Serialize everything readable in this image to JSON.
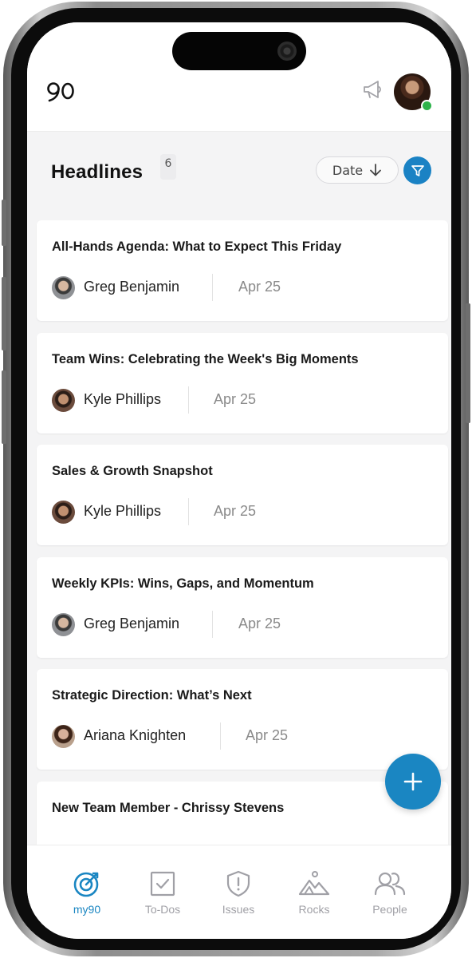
{
  "app": {
    "logo_text": "90",
    "accent_color": "#1a86c2",
    "online_color": "#2db34a"
  },
  "header": {
    "announcement_icon": "megaphone-icon",
    "user_avatar": "user-avatar"
  },
  "page": {
    "title": "Headlines",
    "count": "6",
    "sort_label": "Date",
    "sort_direction_icon": "arrow-down-icon",
    "filter_icon": "filter-icon"
  },
  "headlines": [
    {
      "title": "All-Hands Agenda: What to Expect This Friday",
      "author": "Greg Benjamin",
      "date": "Apr 25"
    },
    {
      "title": "Team Wins: Celebrating the Week's Big Moments",
      "author": "Kyle Phillips",
      "date": "Apr 25"
    },
    {
      "title": "Sales & Growth Snapshot",
      "author": "Kyle Phillips",
      "date": "Apr 25"
    },
    {
      "title": "Weekly KPIs: Wins, Gaps, and Momentum",
      "author": "Greg Benjamin",
      "date": "Apr 25"
    },
    {
      "title": "Strategic Direction: What’s Next",
      "author": "Ariana Knighten",
      "date": "Apr 25"
    },
    {
      "title": "New Team Member - Chrissy Stevens",
      "author": "",
      "date": ""
    }
  ],
  "fab": {
    "icon": "plus-icon"
  },
  "nav": [
    {
      "label": "my90",
      "icon": "target-icon",
      "active": true
    },
    {
      "label": "To-Dos",
      "icon": "checkbox-icon",
      "active": false
    },
    {
      "label": "Issues",
      "icon": "shield-alert-icon",
      "active": false
    },
    {
      "label": "Rocks",
      "icon": "mountain-icon",
      "active": false
    },
    {
      "label": "People",
      "icon": "people-icon",
      "active": false
    }
  ]
}
